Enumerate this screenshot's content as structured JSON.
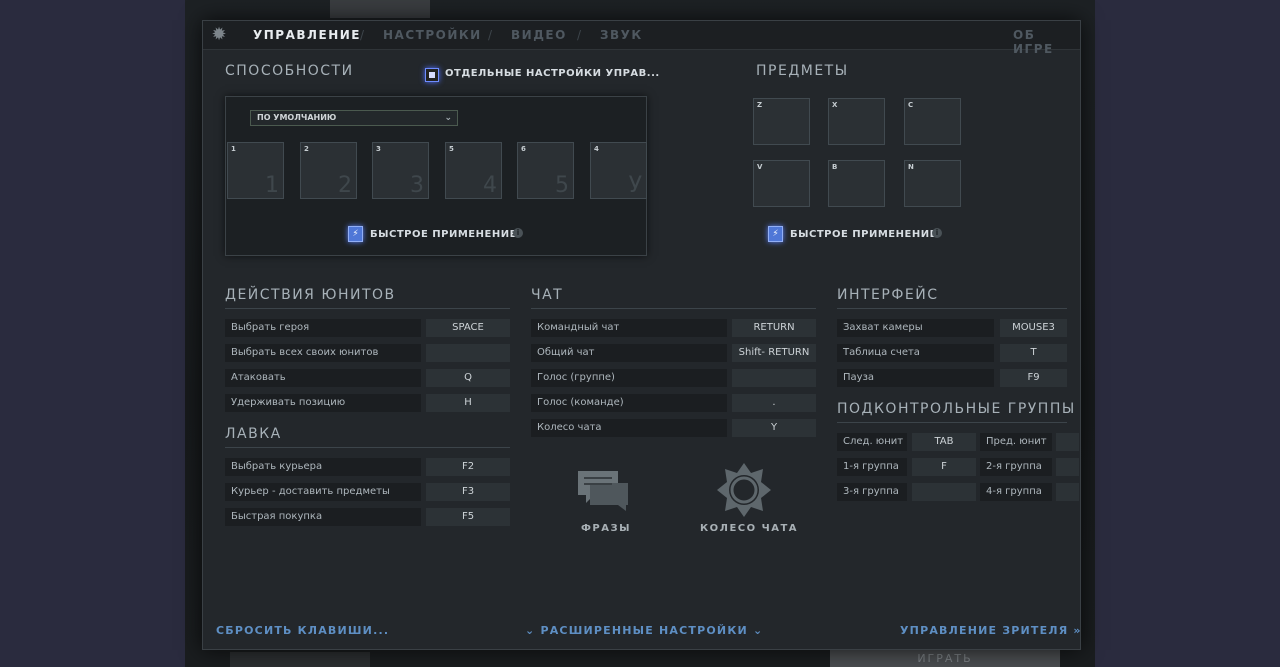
{
  "tabs": [
    {
      "label": "УПРАВЛЕНИЕ",
      "active": true
    },
    {
      "label": "НАСТРОЙКИ",
      "active": false
    },
    {
      "label": "ВИДЕО",
      "active": false
    },
    {
      "label": "ЗВУК",
      "active": false
    }
  ],
  "about_label": "ОБ ИГРЕ",
  "abilities": {
    "title": "СПОСОБНОСТИ",
    "separate_settings_label": "ОТДЕЛЬНЫЕ НАСТРОЙКИ УПРАВ...",
    "preset_value": "ПО УМОЛЧАНИЮ",
    "slots": [
      {
        "key": "1",
        "label": "1"
      },
      {
        "key": "2",
        "label": "2"
      },
      {
        "key": "3",
        "label": "3"
      },
      {
        "key": "5",
        "label": "4"
      },
      {
        "key": "6",
        "label": "5"
      },
      {
        "key": "4",
        "label": "У"
      }
    ],
    "quick_cast_label": "БЫСТРОЕ ПРИМЕНЕНИЕ"
  },
  "items": {
    "title": "ПРЕДМЕТЫ",
    "slots": [
      "Z",
      "X",
      "C",
      "V",
      "B",
      "N"
    ],
    "quick_cast_label": "БЫСТРОЕ ПРИМЕНЕНИЕ"
  },
  "unit_actions": {
    "title": "ДЕЙСТВИЯ ЮНИТОВ",
    "rows": [
      {
        "label": "Выбрать героя",
        "key": "SPACE"
      },
      {
        "label": "Выбрать всех своих юнитов",
        "key": ""
      },
      {
        "label": "Атаковать",
        "key": "Q"
      },
      {
        "label": "Удерживать позицию",
        "key": "H"
      }
    ]
  },
  "shop": {
    "title": "ЛАВКА",
    "rows": [
      {
        "label": "Выбрать курьера",
        "key": "F2"
      },
      {
        "label": "Курьер - доставить предметы",
        "key": "F3"
      },
      {
        "label": "Быстрая покупка",
        "key": "F5"
      }
    ]
  },
  "chat": {
    "title": "ЧАТ",
    "rows": [
      {
        "label": "Командный чат",
        "key": "RETURN"
      },
      {
        "label": "Общий чат",
        "key": "Shift- RETURN"
      },
      {
        "label": "Голос (группе)",
        "key": ""
      },
      {
        "label": "Голос (команде)",
        "key": "."
      },
      {
        "label": "Колесо чата",
        "key": "Y"
      }
    ],
    "phrases_label": "ФРАЗЫ",
    "wheel_label": "КОЛЕСО ЧАТА"
  },
  "interface": {
    "title": "ИНТЕРФЕЙС",
    "rows": [
      {
        "label": "Захват камеры",
        "key": "MOUSE3"
      },
      {
        "label": "Таблица счета",
        "key": "T"
      },
      {
        "label": "Пауза",
        "key": "F9"
      }
    ]
  },
  "control_groups": {
    "title": "ПОДКОНТРОЛЬНЫЕ ГРУППЫ",
    "left": [
      {
        "label": "След. юнит",
        "key": "TAB"
      },
      {
        "label": "1-я группа",
        "key": "F"
      },
      {
        "label": "3-я группа",
        "key": ""
      }
    ],
    "right": [
      {
        "label": "Пред. юнит",
        "key": ""
      },
      {
        "label": "2-я группа",
        "key": ""
      },
      {
        "label": "4-я группа",
        "key": ""
      }
    ]
  },
  "bottom": {
    "reset_label": "СБРОСИТЬ КЛАВИШИ...",
    "advanced_label": "РАСШИРЕННЫЕ НАСТРОЙКИ",
    "spectator_label": "УПРАВЛЕНИЕ ЗРИТЕЛЯ"
  },
  "background": {
    "play_label": "ИГРАТЬ"
  }
}
